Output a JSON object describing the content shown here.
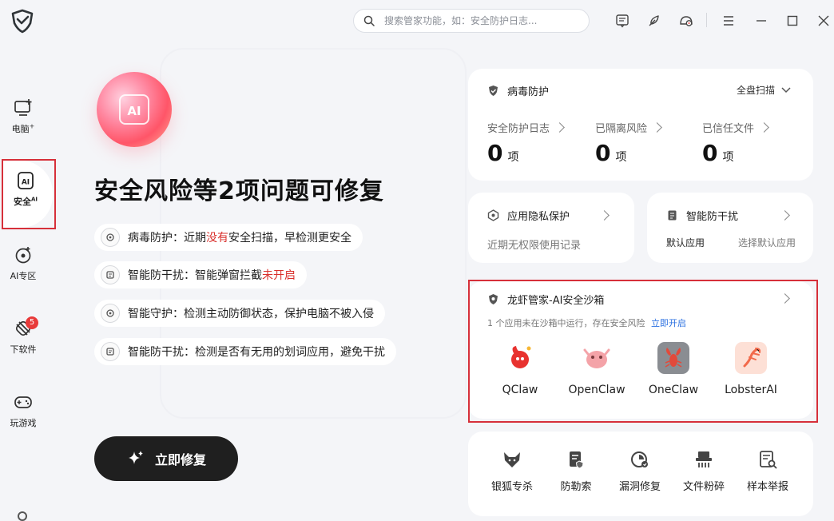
{
  "search": {
    "placeholder": "搜索管家功能，如：安全防护日志..."
  },
  "sidebar": {
    "items": [
      {
        "label": "电脑",
        "sup": "+"
      },
      {
        "label": "安全",
        "sup": "AI"
      },
      {
        "label": "AI专区"
      },
      {
        "label": "下软件",
        "badge": "5"
      },
      {
        "label": "玩游戏"
      }
    ]
  },
  "hero": {
    "ai_chip": "AI",
    "title": "安全风险等2项问题可修复",
    "issues": [
      {
        "prefix": "病毒防护：近期",
        "highlight": "没有",
        "suffix": "安全扫描，早检测更安全"
      },
      {
        "prefix": "智能防干扰：智能弹窗拦截",
        "highlight": "未开启",
        "suffix": ""
      },
      {
        "prefix": "智能守护：检测主动防御状态，保护电脑不被入侵",
        "highlight": "",
        "suffix": ""
      },
      {
        "prefix": "智能防干扰：检测是否有无用的划词应用，避免干扰",
        "highlight": "",
        "suffix": ""
      }
    ],
    "fix_button": "立即修复"
  },
  "virus": {
    "title": "病毒防护",
    "scan": "全盘扫描",
    "stats": [
      {
        "label": "安全防护日志",
        "value": "0",
        "unit": "项"
      },
      {
        "label": "已隔离风险",
        "value": "0",
        "unit": "项"
      },
      {
        "label": "已信任文件",
        "value": "0",
        "unit": "项"
      }
    ]
  },
  "privacy": {
    "title": "应用隐私保护",
    "desc": "近期无权限使用记录"
  },
  "anti": {
    "title": "智能防干扰",
    "left": "默认应用",
    "right": "选择默认应用"
  },
  "sandbox": {
    "title": "龙虾管家-AI安全沙箱",
    "desc": "1 个应用未在沙箱中运行，存在安全风险",
    "link": "立即开启",
    "apps": [
      {
        "name": "QClaw",
        "color": "#e8322f"
      },
      {
        "name": "OpenClaw",
        "color": "#f4a3a8"
      },
      {
        "name": "OneClaw",
        "color": "#e24a3b"
      },
      {
        "name": "LobsterAI",
        "color": "#f26a4b"
      }
    ]
  },
  "tools": [
    {
      "label": "银狐专杀",
      "icon": "fox-icon"
    },
    {
      "label": "防勒索",
      "icon": "shield-doc-icon"
    },
    {
      "label": "漏洞修复",
      "icon": "patch-icon"
    },
    {
      "label": "文件粉碎",
      "icon": "shredder-icon"
    },
    {
      "label": "样本举报",
      "icon": "report-icon"
    }
  ],
  "colors": {
    "accent_red": "#d9302c",
    "link_blue": "#2a6fe0",
    "button_dark": "#1f1f1f"
  }
}
